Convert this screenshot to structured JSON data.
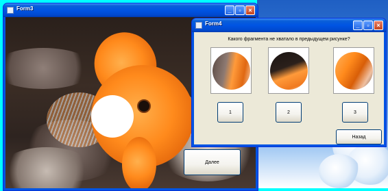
{
  "form3": {
    "title": "Form3",
    "next_button": "Далее"
  },
  "form4": {
    "title": "Form4",
    "question": "Какого фрагмента не хватало в предыдущем рисунке?",
    "options": [
      {
        "label": "1"
      },
      {
        "label": "2"
      },
      {
        "label": "3"
      }
    ],
    "back_button": "Назад"
  },
  "icons": [
    "minimize-icon",
    "maximize-icon",
    "close-icon",
    "window-app-icon"
  ],
  "colors": {
    "desktop": "#00ffff",
    "xp_title_blue": "#0054e3",
    "dialog_face": "#ece9d8",
    "close_red": "#c4451d"
  }
}
